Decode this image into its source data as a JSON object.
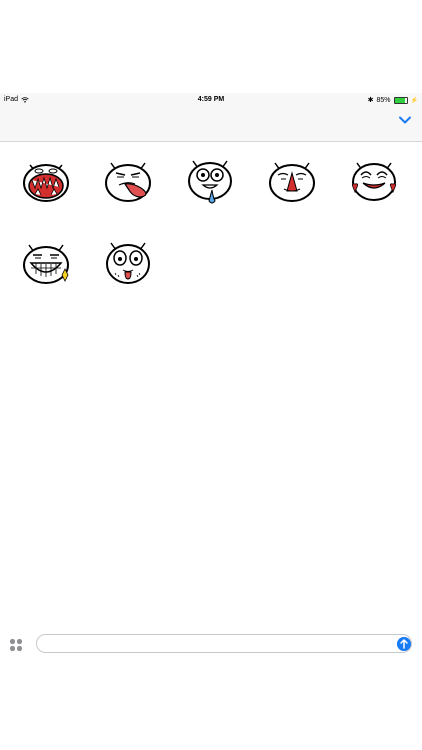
{
  "status_bar": {
    "device": "iPad",
    "time": "4:59 PM",
    "battery_percent": "85%",
    "battery_level": 0.85,
    "battery_color": "#2fcf3f"
  },
  "nav": {
    "collapse_icon": "chevron-down-icon",
    "accent_color": "#1a7cf5"
  },
  "stickers": [
    {
      "name": "sticker-laughing-teeth",
      "expression": "laughing"
    },
    {
      "name": "sticker-tongue-out",
      "expression": "tongue-out"
    },
    {
      "name": "sticker-drooling",
      "expression": "drooling"
    },
    {
      "name": "sticker-nosebleed",
      "expression": "nosebleed"
    },
    {
      "name": "sticker-blushing-hearts",
      "expression": "love"
    },
    {
      "name": "sticker-grinning-sparkle",
      "expression": "grinning"
    },
    {
      "name": "sticker-wide-eyed",
      "expression": "wide-eyed"
    }
  ],
  "composer": {
    "apps_icon": "apps-icon",
    "send_icon": "send-arrow-icon",
    "placeholder": ""
  }
}
